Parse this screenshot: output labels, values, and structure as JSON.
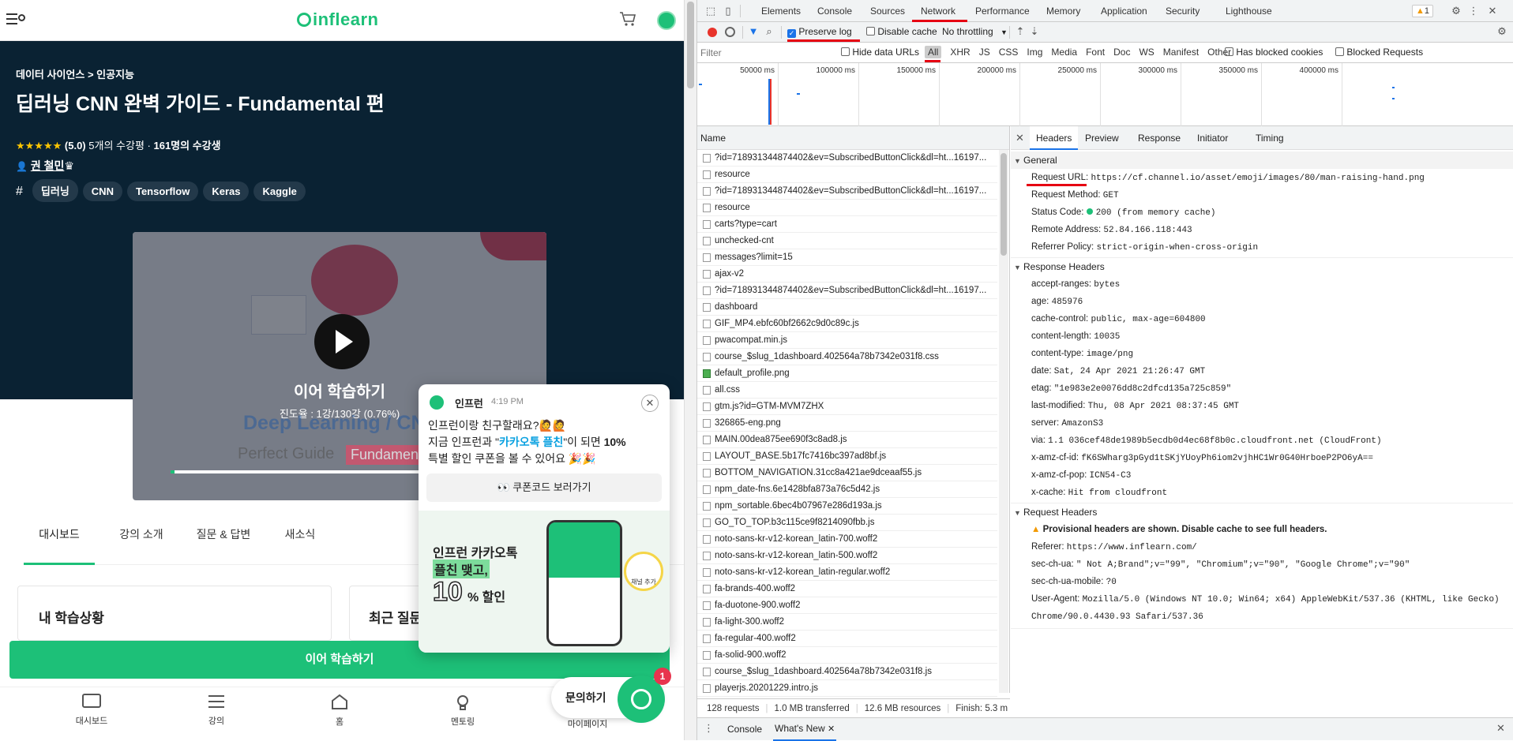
{
  "site": {
    "logo": "inflearn",
    "breadcrumb": "데이터 사이언스 > 인공지능",
    "course_title": "딥러닝 CNN 완벽 가이드 - Fundamental 편",
    "rating_stars": "★★★★★",
    "rating": "(5.0)",
    "reviews": "5개의 수강평 ·",
    "students": "161명의 수강생",
    "instructor": "권 철민",
    "tags": [
      "딥러닝",
      "CNN",
      "Tensorflow",
      "Keras",
      "Kaggle"
    ],
    "video": {
      "continue_label": "이어 학습하기",
      "progress_text": "진도율 : 1강/130강 (0.76%)",
      "progress": 0.0076,
      "thumb_text_1": "Deep Learning / CN",
      "thumb_text_2": "Perfect Guide",
      "thumb_text_3": "Fundamen"
    },
    "tabs": [
      "대시보드",
      "강의 소개",
      "질문 & 답변",
      "새소식"
    ],
    "card_1_title": "내 학습상황",
    "card_2_title": "최근 질문",
    "cta": "이어 학습하기",
    "bottom_nav": [
      "대시보드",
      "강의",
      "홈",
      "멘토링",
      "마이페이지"
    ],
    "inquiry": "문의하기",
    "inquiry_badge": "1",
    "popup": {
      "sender": "인프런",
      "time": "4:19 PM",
      "line1": "인프런이랑 친구할래요?🙋🙋",
      "line2_a": "지금 인프런과 \"",
      "line2_hl": "카카오톡 플친",
      "line2_b": "\"이 되면 ",
      "line2_bold": "10%",
      "line3": "특별 할인 쿠폰을 볼 수 있어요 🎉🎉",
      "button": "👀 쿠폰코드 보러가기",
      "promo_1": "인프런 카카오톡",
      "promo_2": "플친 맺고,",
      "promo_num": "10",
      "promo_3": "% 할인",
      "bubble": "채널 추가"
    }
  },
  "devtools": {
    "tabs": [
      "Elements",
      "Console",
      "Sources",
      "Network",
      "Performance",
      "Memory",
      "Application",
      "Security",
      "Lighthouse"
    ],
    "active_tab": "Network",
    "warn_count": "1",
    "preserve_log": "Preserve log",
    "disable_cache": "Disable cache",
    "throttling": "No throttling",
    "filter_placeholder": "Filter",
    "hide_data_urls": "Hide data URLs",
    "filter_types": [
      "All",
      "XHR",
      "JS",
      "CSS",
      "Img",
      "Media",
      "Font",
      "Doc",
      "WS",
      "Manifest",
      "Other"
    ],
    "has_blocked": "Has blocked cookies",
    "blocked_req": "Blocked Requests",
    "timeline_ticks": [
      "50000 ms",
      "100000 ms",
      "150000 ms",
      "200000 ms",
      "250000 ms",
      "300000 ms",
      "350000 ms",
      "400000 ms"
    ],
    "name_header": "Name",
    "requests": [
      "?id=718931344874402&ev=SubscribedButtonClick&dl=ht...16197...",
      "resource",
      "?id=718931344874402&ev=SubscribedButtonClick&dl=ht...16197...",
      "resource",
      "carts?type=cart",
      "unchecked-cnt",
      "messages?limit=15",
      "ajax-v2",
      "?id=718931344874402&ev=SubscribedButtonClick&dl=ht...16197...",
      "dashboard",
      "GIF_MP4.ebfc60bf2662c9d0c89c.js",
      "pwacompat.min.js",
      "course_$slug_1dashboard.402564a78b7342e031f8.css",
      "default_profile.png",
      "all.css",
      "gtm.js?id=GTM-MVM7ZHX",
      "326865-eng.png",
      "MAIN.00dea875ee690f3c8ad8.js",
      "LAYOUT_BASE.5b17fc7416bc397ad8bf.js",
      "BOTTOM_NAVIGATION.31cc8a421ae9dceaaf55.js",
      "npm_date-fns.6e1428bfa873a76c5d42.js",
      "npm_sortable.6bec4b07967e286d193a.js",
      "GO_TO_TOP.b3c115ce9f8214090fbb.js",
      "noto-sans-kr-v12-korean_latin-700.woff2",
      "noto-sans-kr-v12-korean_latin-500.woff2",
      "noto-sans-kr-v12-korean_latin-regular.woff2",
      "fa-brands-400.woff2",
      "fa-duotone-900.woff2",
      "fa-light-300.woff2",
      "fa-regular-400.woff2",
      "fa-solid-900.woff2",
      "course_$slug_1dashboard.402564a78b7342e031f8.js",
      "playerjs.20201229.intro.js"
    ],
    "status_bar": [
      "128 requests",
      "1.0 MB transferred",
      "12.6 MB resources",
      "Finish: 5.3 m"
    ],
    "detail_tabs": [
      "Headers",
      "Preview",
      "Response",
      "Initiator",
      "Timing"
    ],
    "general_title": "General",
    "general": [
      {
        "k": "Request URL:",
        "v": "https://cf.channel.io/asset/emoji/images/80/man-raising-hand.png"
      },
      {
        "k": "Request Method:",
        "v": "GET"
      },
      {
        "k": "Status Code:",
        "v": "200  (from memory cache)"
      },
      {
        "k": "Remote Address:",
        "v": "52.84.166.118:443"
      },
      {
        "k": "Referrer Policy:",
        "v": "strict-origin-when-cross-origin"
      }
    ],
    "response_title": "Response Headers",
    "response": [
      {
        "k": "accept-ranges:",
        "v": "bytes"
      },
      {
        "k": "age:",
        "v": "485976"
      },
      {
        "k": "cache-control:",
        "v": "public, max-age=604800"
      },
      {
        "k": "content-length:",
        "v": "10035"
      },
      {
        "k": "content-type:",
        "v": "image/png"
      },
      {
        "k": "date:",
        "v": "Sat, 24 Apr 2021 21:26:47 GMT"
      },
      {
        "k": "etag:",
        "v": "\"1e983e2e0076dd8c2dfcd135a725c859\""
      },
      {
        "k": "last-modified:",
        "v": "Thu, 08 Apr 2021 08:37:45 GMT"
      },
      {
        "k": "server:",
        "v": "AmazonS3"
      },
      {
        "k": "via:",
        "v": "1.1 036cef48de1989b5ecdb0d4ec68f8b0c.cloudfront.net (CloudFront)"
      },
      {
        "k": "x-amz-cf-id:",
        "v": "fK6SWharg3pGyd1tSKjYUoyPh6iom2vjhHC1Wr0G40HrboeP2PO6yA=="
      },
      {
        "k": "x-amz-cf-pop:",
        "v": "ICN54-C3"
      },
      {
        "k": "x-cache:",
        "v": "Hit from cloudfront"
      }
    ],
    "request_title": "Request Headers",
    "provisional": "Provisional headers are shown. Disable cache to see full headers.",
    "request": [
      {
        "k": "Referer:",
        "v": "https://www.inflearn.com/"
      },
      {
        "k": "sec-ch-ua:",
        "v": "\" Not A;Brand\";v=\"99\", \"Chromium\";v=\"90\", \"Google Chrome\";v=\"90\""
      },
      {
        "k": "sec-ch-ua-mobile:",
        "v": "?0"
      },
      {
        "k": "User-Agent:",
        "v": "Mozilla/5.0 (Windows NT 10.0; Win64; x64) AppleWebKit/537.36 (KHTML, like Gecko)"
      }
    ],
    "ua_cont": "Chrome/90.0.4430.93 Safari/537.36",
    "drawer_tabs": [
      "Console",
      "What's New"
    ]
  },
  "colors": {
    "brand": "#1dc078",
    "hero": "#0a2233",
    "annotation": "#e60012",
    "devtools_blue": "#1a73e8"
  }
}
